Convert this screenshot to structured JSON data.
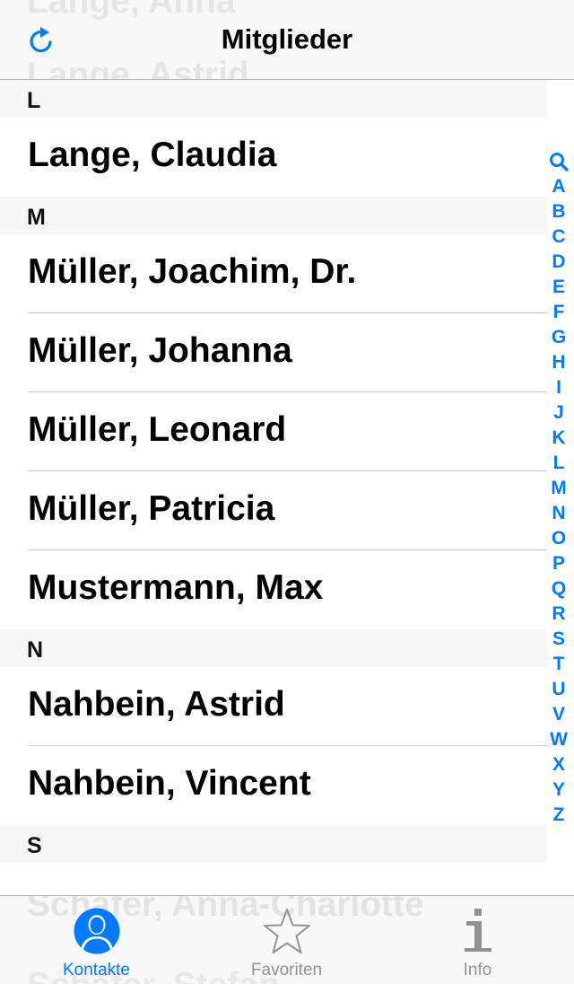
{
  "navbar": {
    "title": "Mitglieder",
    "ghost_above": "Lange, Anna",
    "ghost_below": "Lange, Astrid"
  },
  "sections": [
    {
      "letter": "L",
      "rows": [
        "Lange, Claudia"
      ]
    },
    {
      "letter": "M",
      "rows": [
        "Müller, Joachim, Dr.",
        "Müller, Johanna",
        "Müller, Leonard",
        "Müller, Patricia",
        "Mustermann, Max"
      ]
    },
    {
      "letter": "N",
      "rows": [
        "Nahbein, Astrid",
        "Nahbein, Vincent"
      ]
    },
    {
      "letter": "S",
      "rows": []
    }
  ],
  "index_letters": [
    "A",
    "B",
    "C",
    "D",
    "E",
    "F",
    "G",
    "H",
    "I",
    "J",
    "K",
    "L",
    "M",
    "N",
    "O",
    "P",
    "Q",
    "R",
    "S",
    "T",
    "U",
    "V",
    "W",
    "X",
    "Y",
    "Z"
  ],
  "tabbar": {
    "ghost_text": "Schäfer, Anna-Charlotte",
    "ghost_text2": "Schäfer, Stefan",
    "tabs": [
      {
        "label": "Kontakte",
        "icon": "person-icon",
        "active": true
      },
      {
        "label": "Favoriten",
        "icon": "star-icon",
        "active": false
      },
      {
        "label": "Info",
        "icon": "info-icon",
        "active": false
      }
    ]
  },
  "colors": {
    "accent": "#007aff",
    "inactive": "#929292",
    "section_bg": "#f7f7f7",
    "separator": "#c8c7cc"
  }
}
